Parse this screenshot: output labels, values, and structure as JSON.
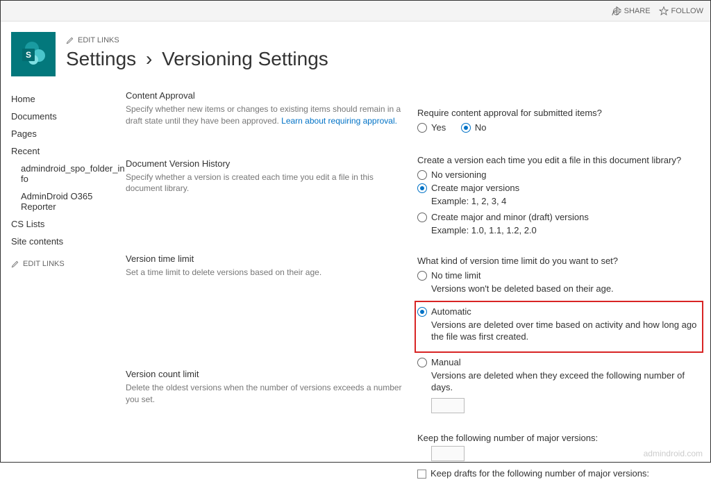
{
  "topbar": {
    "share": "SHARE",
    "follow": "FOLLOW"
  },
  "header": {
    "edit_links": "EDIT LINKS",
    "crumb1": "Settings",
    "crumb2": "Versioning Settings"
  },
  "nav": {
    "home": "Home",
    "documents": "Documents",
    "pages": "Pages",
    "recent": "Recent",
    "recent_sub1": "admindroid_spo_folder_info",
    "recent_sub2": "AdminDroid O365 Reporter",
    "cslists": "CS Lists",
    "sitecontents": "Site contents",
    "edit_links": "EDIT LINKS"
  },
  "sections": {
    "approval": {
      "title": "Content Approval",
      "desc": "Specify whether new items or changes to existing items should remain in a draft state until they have been approved.  ",
      "link": "Learn about requiring approval."
    },
    "dvh": {
      "title": "Document Version History",
      "desc": "Specify whether a version is created each time you edit a file in this document library."
    },
    "vtl": {
      "title": "Version time limit",
      "desc": "Set a time limit to delete versions based on their age."
    },
    "vcl": {
      "title": "Version count limit",
      "desc": "Delete the oldest versions when the number of versions exceeds a number you set."
    }
  },
  "fields": {
    "approval_q": "Require content approval for submitted items?",
    "yes": "Yes",
    "no": "No",
    "dvh_q": "Create a version each time you edit a file in this document library?",
    "no_versioning": "No versioning",
    "create_major": "Create major versions",
    "create_major_ex": "Example: 1, 2, 3, 4",
    "create_minor": "Create major and minor (draft) versions",
    "create_minor_ex": "Example: 1.0, 1.1, 1.2, 2.0",
    "vtl_q": "What kind of version time limit do you want to set?",
    "no_limit": "No time limit",
    "no_limit_sub": "Versions won't be deleted based on their age.",
    "automatic": "Automatic",
    "automatic_sub": "Versions are deleted over time based on activity and how long ago the file was first created.",
    "manual": "Manual",
    "manual_sub": "Versions are deleted when they exceed the following number of days.",
    "keep_major": "Keep the following number of major versions:",
    "keep_drafts": "Keep drafts for the following number of major versions:"
  },
  "watermark": "admindroid.com"
}
